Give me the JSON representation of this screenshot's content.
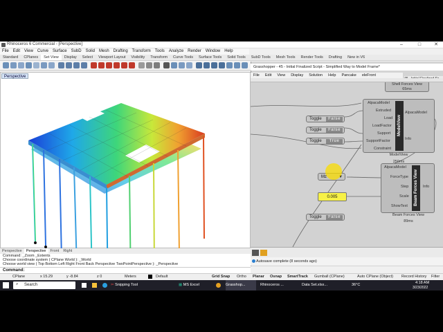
{
  "window": {
    "title": "Rhinoceros 6 Commercial - [Perspective]",
    "controls": [
      "–",
      "□",
      "✕"
    ]
  },
  "rhino_menu": [
    "File",
    "Edit",
    "View",
    "Curve",
    "Surface",
    "SubD",
    "Solid",
    "Mesh",
    "Drafting",
    "Transform",
    "Tools",
    "Analyze",
    "Render",
    "Window",
    "Help"
  ],
  "ribbon_tabs": [
    "Standard",
    "CPlanes",
    "Set View",
    "Display",
    "Select",
    "Viewport Layout",
    "Visibility",
    "Transform",
    "Curve Tools",
    "Surface Tools",
    "Solid Tools",
    "SubD Tools",
    "Mesh Tools",
    "Render Tools",
    "Drafting",
    "New in V6"
  ],
  "active_ribbon_tab": "Set View",
  "viewport": {
    "label": "Perspective",
    "tabs": [
      "Perspective",
      "Perspective",
      "Front",
      "Right"
    ],
    "active_tab_index": 1
  },
  "command_history": [
    "Command: _Zoom  _Extents",
    "Choose coordinate system ( CPlane  World ): _World",
    "Choose world view ( Top  Bottom  Left  Right  Front  Back  Perspective  TwoPointPerspective ): _Perspective"
  ],
  "command_prompt": "Command:",
  "status_bar": {
    "cplane": "CPlane",
    "x": "x 15.29",
    "y": "y -8.84",
    "z": "z 0",
    "units": "Meters",
    "layer": "Default",
    "toggles": [
      "Grid Snap",
      "Ortho",
      "Planar",
      "Osnap",
      "SmartTrack",
      "Gumball (CPlane)",
      "Auto CPlane (Object)",
      "Record History",
      "Filter"
    ]
  },
  "grasshopper": {
    "title": "Grasshopper - 45 - Initial Finalized Script - Simplified Way to Model Frame*",
    "title_right": "45 - Initial Finalized Sc",
    "menu": [
      "File",
      "Edit",
      "View",
      "Display",
      "Solution",
      "Help",
      "Pancake",
      "eleFront"
    ],
    "toggles": [
      {
        "label": "Toggle",
        "value": "False"
      },
      {
        "label": "Toggle",
        "value": "False"
      },
      {
        "label": "Toggle",
        "value": "True"
      },
      {
        "label": "Toggle",
        "value": "False"
      }
    ],
    "shell_forces": {
      "caption": "Shell Forces View",
      "time": "65ms"
    },
    "model_view": {
      "inputs": [
        "AlpacaModel",
        "Extruded",
        "Load",
        "LoadFactor",
        "Support",
        "SupportFactor",
        "Constraint"
      ],
      "name": "ModelView",
      "outputs": [
        "AlpacaModel",
        "Info"
      ],
      "caption": "ModelView",
      "time": "250ms"
    },
    "beam_forces": {
      "inputs": [
        "AlpacaModel",
        "ForceType",
        "Step",
        "Scale",
        "ShowText"
      ],
      "name": "Beam Forces View",
      "outputs": [
        "Info"
      ],
      "caption": "Beam Forces View",
      "time": "89ms"
    },
    "value_list": "Mz",
    "slider_value": "0.005",
    "status": "Autosave complete (8 seconds ago)"
  },
  "taskbar": {
    "search": "Search",
    "apps": [
      "Snipping Tool",
      "MS Excel",
      "Grasshop...",
      "Rhinoceros ...",
      "Data Set.xlsx..."
    ],
    "temperature": "36°C",
    "time": "4:18 AM",
    "date": "3/23/2022"
  }
}
